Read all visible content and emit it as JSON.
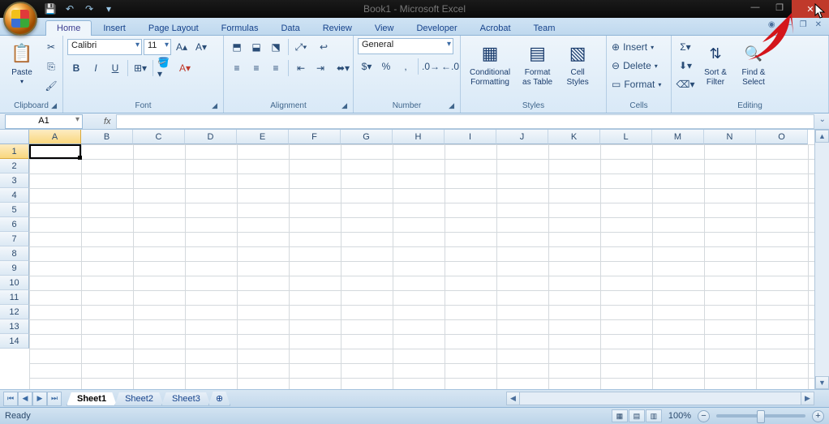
{
  "window": {
    "title": "Book1 - Microsoft Excel"
  },
  "tabs": [
    "Home",
    "Insert",
    "Page Layout",
    "Formulas",
    "Data",
    "Review",
    "View",
    "Developer",
    "Acrobat",
    "Team"
  ],
  "active_tab": "Home",
  "ribbon": {
    "clipboard": {
      "label": "Clipboard",
      "paste": "Paste"
    },
    "font": {
      "label": "Font",
      "name": "Calibri",
      "size": "11",
      "bold": "B",
      "italic": "I",
      "underline": "U"
    },
    "alignment": {
      "label": "Alignment"
    },
    "number": {
      "label": "Number",
      "format": "General"
    },
    "styles": {
      "label": "Styles",
      "conditional_l1": "Conditional",
      "conditional_l2": "Formatting",
      "table_l1": "Format",
      "table_l2": "as Table",
      "cell_l1": "Cell",
      "cell_l2": "Styles"
    },
    "cells": {
      "label": "Cells",
      "insert": "Insert",
      "delete": "Delete",
      "format": "Format"
    },
    "editing": {
      "label": "Editing",
      "sortfilter_l1": "Sort &",
      "sortfilter_l2": "Filter",
      "findselect_l1": "Find &",
      "findselect_l2": "Select"
    }
  },
  "name_box": "A1",
  "formula_bar_label": "fx",
  "columns": [
    "A",
    "B",
    "C",
    "D",
    "E",
    "F",
    "G",
    "H",
    "I",
    "J",
    "K",
    "L",
    "M",
    "N",
    "O"
  ],
  "rows": [
    "1",
    "2",
    "3",
    "4",
    "5",
    "6",
    "7",
    "8",
    "9",
    "10",
    "11",
    "12",
    "13",
    "14"
  ],
  "selected_col": "A",
  "selected_row": "1",
  "sheets": [
    "Sheet1",
    "Sheet2",
    "Sheet3"
  ],
  "active_sheet": "Sheet1",
  "status": {
    "ready": "Ready",
    "zoom": "100%"
  }
}
